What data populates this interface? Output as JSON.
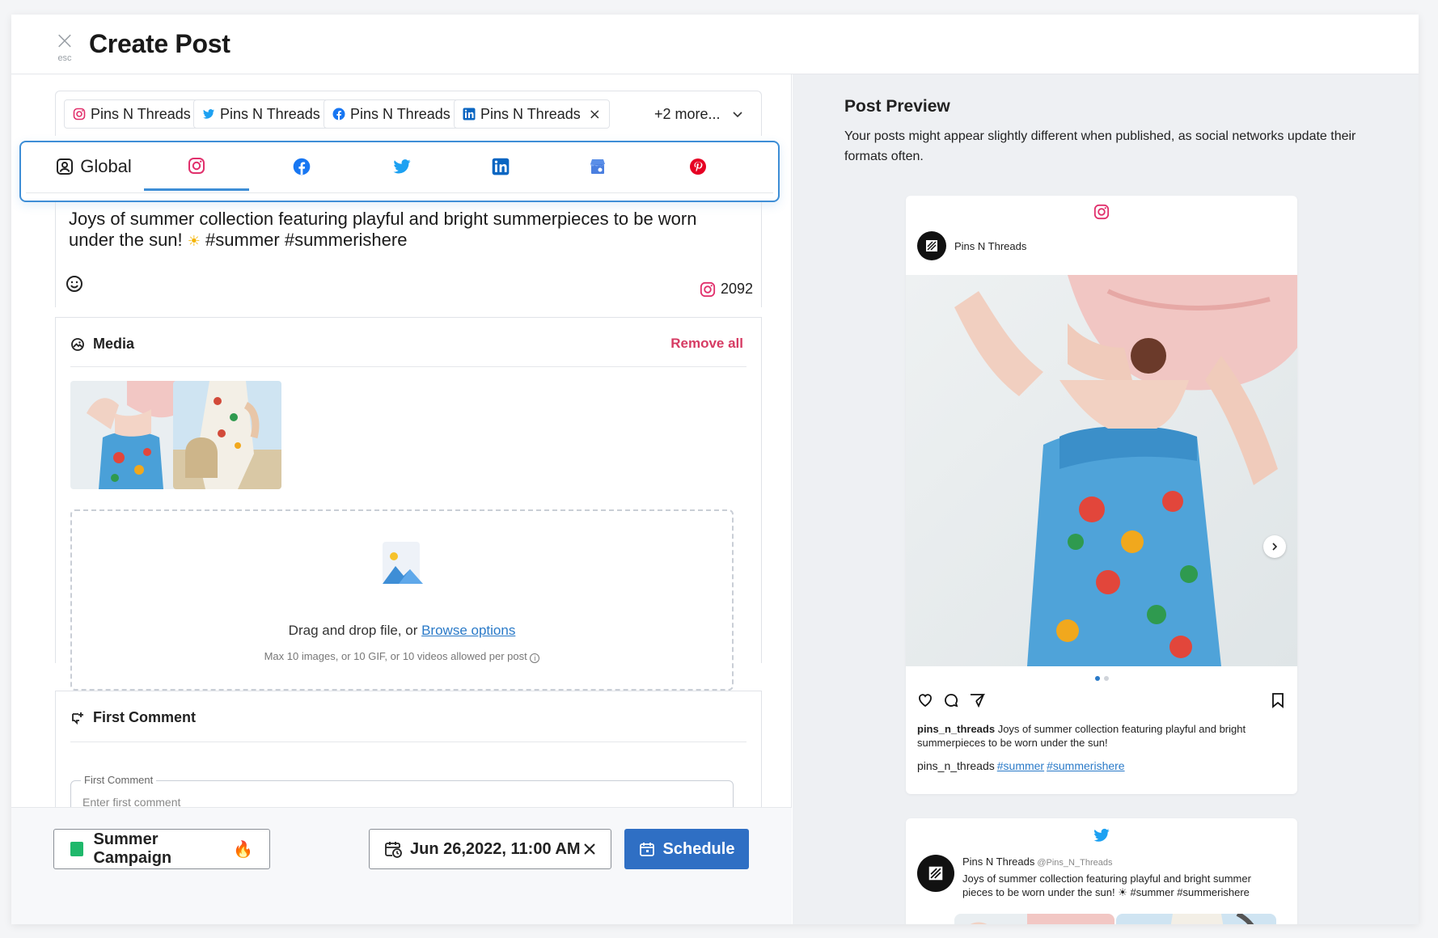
{
  "header": {
    "close_label": "×",
    "esc_label": "esc",
    "title": "Create Post"
  },
  "accounts": [
    {
      "name": "Pins N Threads",
      "network": "instagram"
    },
    {
      "name": "Pins N Threads",
      "network": "twitter"
    },
    {
      "name": "Pins N Threads",
      "network": "facebook"
    },
    {
      "name": "Pins N Threads",
      "network": "linkedin"
    }
  ],
  "accounts_more": "+2 more...",
  "tabs": {
    "global_label": "Global",
    "active": "instagram",
    "networks": [
      "instagram",
      "facebook",
      "twitter",
      "linkedin",
      "google-business",
      "pinterest"
    ]
  },
  "editor": {
    "text_before_emoji": "Joys of summer collection featuring playful and bright summerpieces to be worn under the sun! ",
    "emoji": "☀",
    "text_after_emoji": " #summer #summerishere",
    "char_count": "2092"
  },
  "media": {
    "title": "Media",
    "remove_all": "Remove all",
    "drop_text": "Drag and drop file, or ",
    "browse_link": "Browse options",
    "drop_sub": "Max 10 images, or 10 GIF, or 10 videos allowed per post"
  },
  "first_comment": {
    "title": "First Comment",
    "field_label": "First Comment",
    "placeholder": "Enter first comment"
  },
  "footer": {
    "campaign": "Summer Campaign",
    "campaign_emoji": "🔥",
    "datetime": "Jun 26,2022, 11:00 AM",
    "schedule_label": "Schedule"
  },
  "preview": {
    "title": "Post Preview",
    "description": "Your posts might appear slightly different when published, as social networks update their formats often.",
    "instagram": {
      "profile_name": "Pins N Threads",
      "caption_user": "pins_n_threads",
      "caption_text": " Joys of summer collection featuring playful and bright summerpieces to be worn under the sun!",
      "tags_user": "pins_n_threads",
      "tags": [
        "#summer",
        "#summerishere"
      ]
    },
    "twitter": {
      "name": "Pins N Threads",
      "handle": "@Pins_N_Threads",
      "text": "Joys of summer collection featuring playful and bright summer pieces to be worn under the sun! ☀ #summer #summerishere"
    }
  },
  "colors": {
    "accent": "#3e8ed6",
    "primary_button": "#2f6fc4",
    "danger": "#d63b63",
    "campaign": "#1fb86b",
    "instagram": "#e1306c",
    "facebook": "#1877f2",
    "twitter": "#1da1f2",
    "linkedin": "#0a66c2",
    "pinterest": "#e60023"
  }
}
